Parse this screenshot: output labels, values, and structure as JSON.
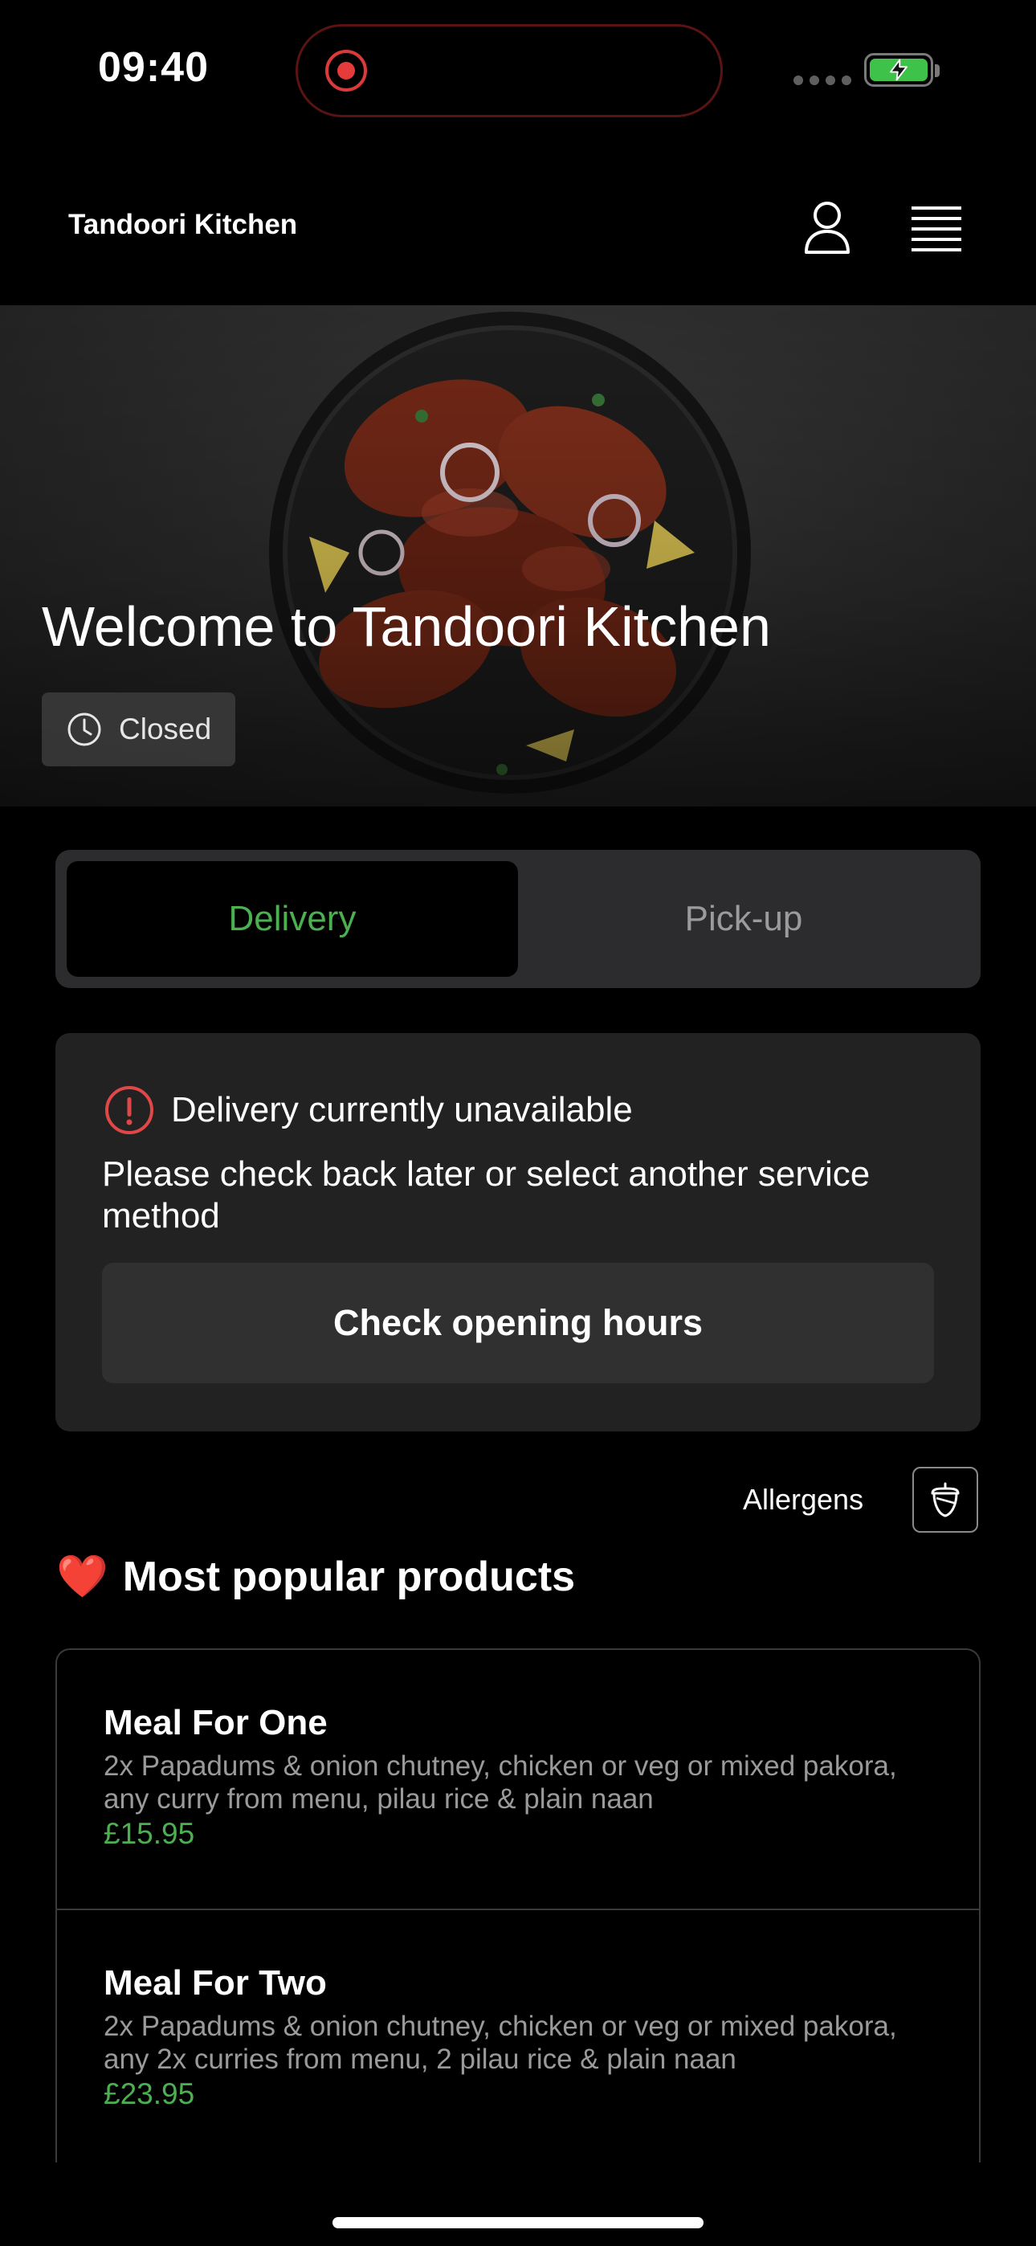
{
  "status_bar": {
    "time": "09:40",
    "battery_color": "#3ec24a",
    "recording_color": "#e53b3b"
  },
  "header": {
    "brand": "Tandoori Kitchen",
    "account_icon": "person-icon",
    "menu_icon": "hamburger-menu-icon"
  },
  "hero": {
    "title": "Welcome to Tandoori Kitchen",
    "status": "Closed",
    "status_icon": "clock-icon"
  },
  "service_toggle": {
    "options": [
      {
        "label": "Delivery",
        "active": true
      },
      {
        "label": "Pick-up",
        "active": false
      }
    ],
    "active_color": "#4caf50"
  },
  "alert": {
    "icon": "info-icon",
    "heading": "Delivery currently unavailable",
    "body": "Please check back later or select another service method",
    "button_label": "Check opening hours",
    "icon_color": "#e04848"
  },
  "allergens": {
    "label": "Allergens",
    "icon": "acorn-icon"
  },
  "popular": {
    "emoji": "❤️",
    "title": "Most popular products",
    "products": [
      {
        "name": "Meal For One",
        "description": "2x Papadums & onion chutney, chicken or veg or mixed pakora, any curry from menu, pilau rice & plain naan",
        "price": "£15.95"
      },
      {
        "name": "Meal For Two",
        "description": "2x Papadums & onion chutney, chicken or veg or mixed pakora, any 2x curries from menu, 2 pilau rice & plain naan",
        "price": "£23.95"
      }
    ]
  }
}
